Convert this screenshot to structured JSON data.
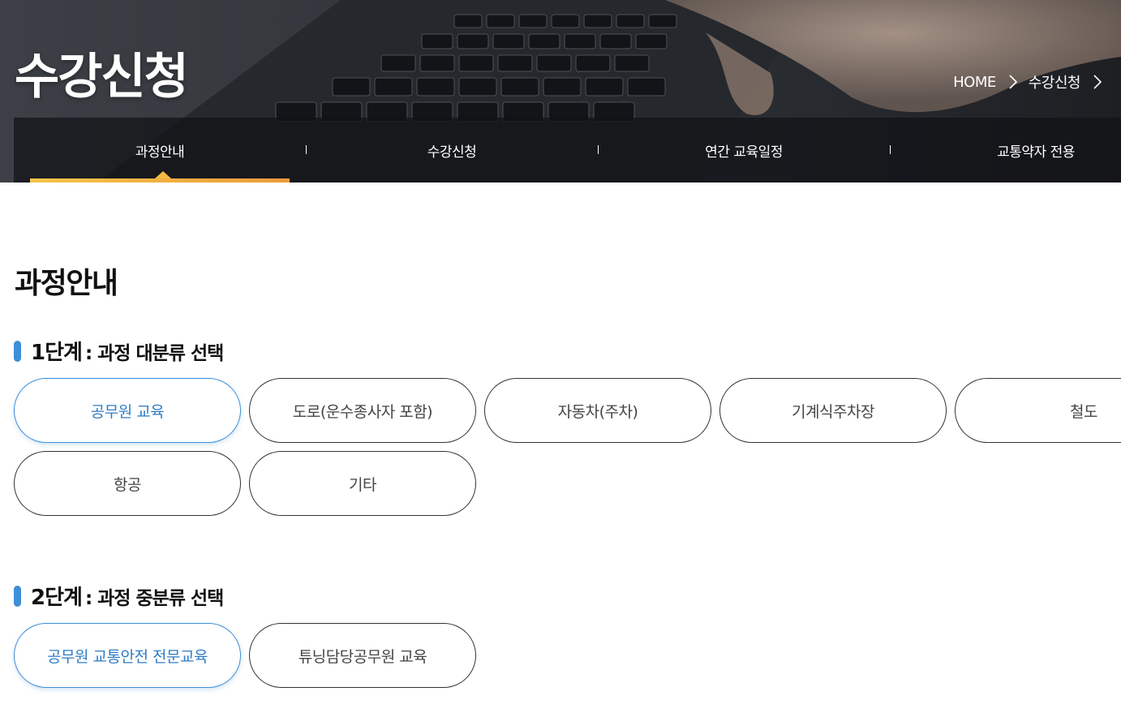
{
  "header": {
    "title": "수강신청",
    "breadcrumb": [
      "HOME",
      "수강신청"
    ]
  },
  "nav": {
    "items": [
      {
        "label": "과정안내",
        "active": true
      },
      {
        "label": "수강신청",
        "active": false
      },
      {
        "label": "연간 교육일정",
        "active": false
      },
      {
        "label": "교통약자 전용",
        "active": false
      }
    ]
  },
  "main": {
    "title": "과정안내",
    "step1": {
      "num": "1단계",
      "rest": ": 과정 대분류 선택",
      "options": [
        {
          "label": "공무원 교육",
          "selected": true
        },
        {
          "label": "도로(운수종사자 포함)",
          "selected": false
        },
        {
          "label": "자동차(주차)",
          "selected": false
        },
        {
          "label": "기계식주차장",
          "selected": false
        },
        {
          "label": "철도",
          "selected": false
        },
        {
          "label": "항공",
          "selected": false
        },
        {
          "label": "기타",
          "selected": false
        }
      ]
    },
    "step2": {
      "num": "2단계",
      "rest": ": 과정 중분류 선택",
      "options": [
        {
          "label": "공무원 교통안전 전문교육",
          "selected": true
        },
        {
          "label": "튜닝담당공무원 교육",
          "selected": false
        }
      ]
    }
  },
  "colors": {
    "accent": "#3d8fd8",
    "active_bar": "#f4b842",
    "selected_text": "#2f7cc6"
  }
}
